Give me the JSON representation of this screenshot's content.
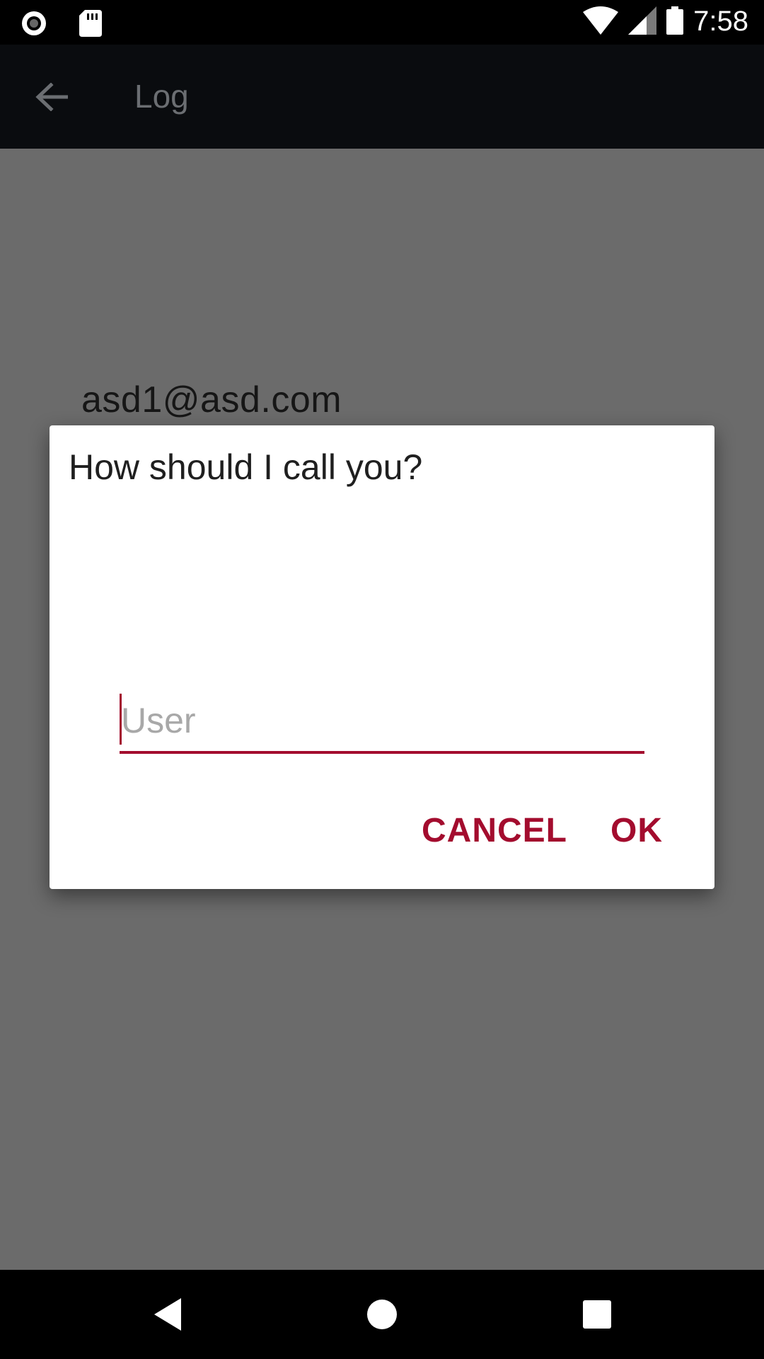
{
  "status_bar": {
    "time": "7:58",
    "icons": [
      "record-icon",
      "sd-card-icon",
      "wifi-icon",
      "signal-icon",
      "battery-icon"
    ]
  },
  "app_bar": {
    "title": "Log",
    "back_icon": "arrow-back-icon"
  },
  "content": {
    "email": "asd1@asd.com"
  },
  "dialog": {
    "title": "How should I call you?",
    "input": {
      "value": "",
      "placeholder": "User"
    },
    "cancel_label": "CANCEL",
    "ok_label": "OK"
  },
  "nav_bar": {
    "icons": [
      "nav-back-icon",
      "nav-home-icon",
      "nav-recents-icon"
    ]
  },
  "colors": {
    "accent": "#a30c2e",
    "app_bar": "#0a0c0f",
    "scrim_background": "#6b6b6b",
    "dialog_background": "#ffffff"
  }
}
